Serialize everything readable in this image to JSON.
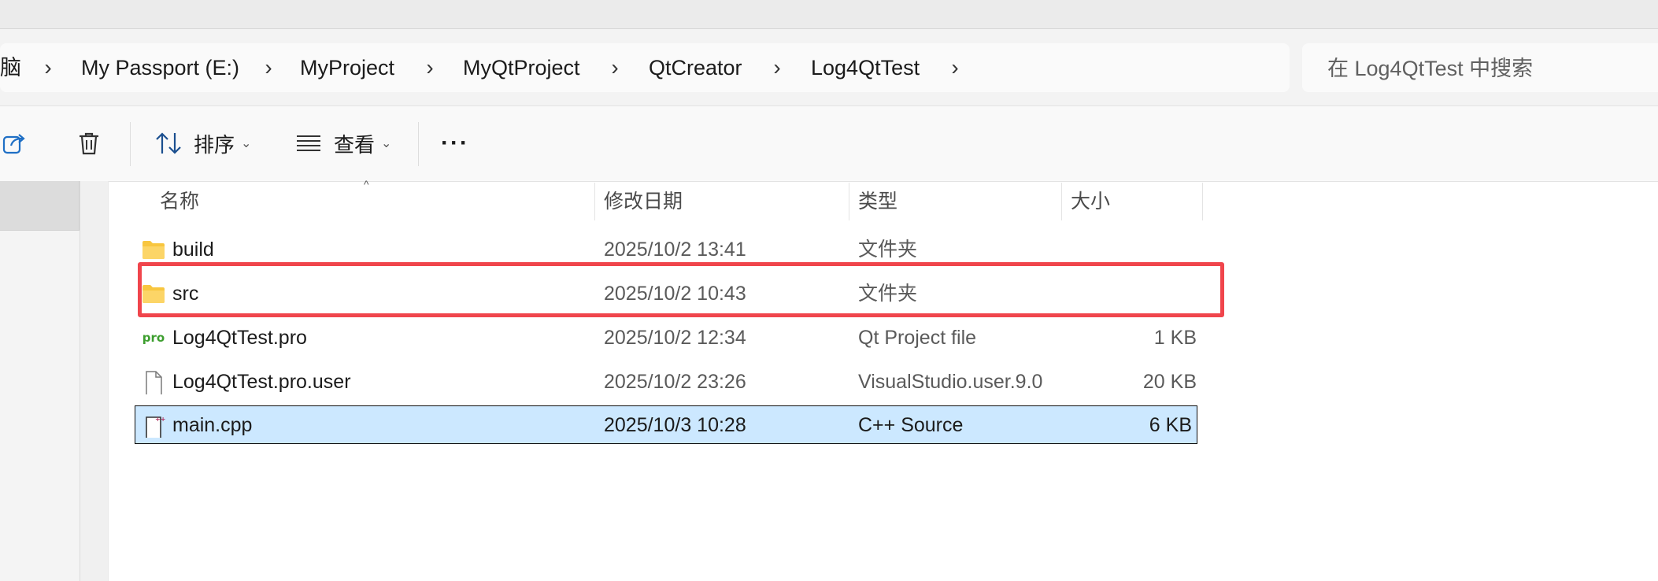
{
  "breadcrumb": {
    "items": [
      "脑",
      "My Passport (E:)",
      "MyProject",
      "MyQtProject",
      "QtCreator",
      "Log4QtTest"
    ]
  },
  "search": {
    "placeholder": "在 Log4QtTest 中搜索"
  },
  "toolbar": {
    "sort_label": "排序",
    "view_label": "查看",
    "more_label": "···"
  },
  "columns": {
    "name": "名称",
    "modified": "修改日期",
    "type": "类型",
    "size": "大小"
  },
  "files": [
    {
      "name": "build",
      "modified": "2025/10/2 13:41",
      "type": "文件夹",
      "size": "",
      "icon": "folder-icon"
    },
    {
      "name": "src",
      "modified": "2025/10/2 10:43",
      "type": "文件夹",
      "size": "",
      "icon": "folder-icon",
      "highlighted": true
    },
    {
      "name": "Log4QtTest.pro",
      "modified": "2025/10/2 12:34",
      "type": "Qt Project file",
      "size": "1 KB",
      "icon": "qt-pro-file-icon",
      "icon_text": "pro"
    },
    {
      "name": "Log4QtTest.pro.user",
      "modified": "2025/10/2 23:26",
      "type": "VisualStudio.user.9.0",
      "size": "20 KB",
      "icon": "generic-file-icon"
    },
    {
      "name": "main.cpp",
      "modified": "2025/10/3 10:28",
      "type": "C++ Source",
      "size": "6 KB",
      "icon": "cpp-file-icon",
      "selected": true
    }
  ],
  "colors": {
    "selection": "#cce8ff",
    "highlight_border": "#f0454c",
    "folder": "#f8c63f",
    "share_icon": "#1f6fc5"
  }
}
